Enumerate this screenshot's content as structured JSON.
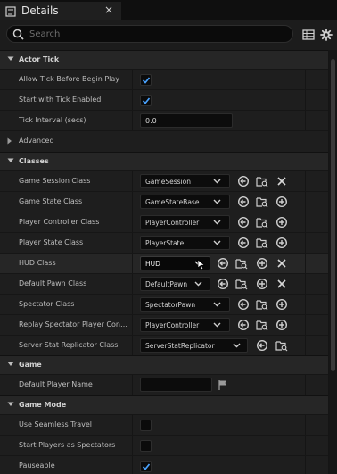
{
  "tab": {
    "title": "Details",
    "close": "×"
  },
  "search": {
    "placeholder": "Search",
    "value": ""
  },
  "sections": {
    "actor_tick": "Actor Tick",
    "classes": "Classes",
    "game": "Game",
    "game_mode": "Game Mode"
  },
  "actor_tick": {
    "allow_tick": {
      "label": "Allow Tick Before Begin Play",
      "checked": true
    },
    "start_tick": {
      "label": "Start with Tick Enabled",
      "checked": true
    },
    "tick_interval": {
      "label": "Tick Interval (secs)",
      "value": "0.0"
    },
    "advanced": "Advanced"
  },
  "classes": {
    "game_session": {
      "label": "Game Session Class",
      "value": "GameSession"
    },
    "game_state": {
      "label": "Game State Class",
      "value": "GameStateBase"
    },
    "player_controller": {
      "label": "Player Controller Class",
      "value": "PlayerController"
    },
    "player_state": {
      "label": "Player State Class",
      "value": "PlayerState"
    },
    "hud": {
      "label": "HUD Class",
      "value": "HUD"
    },
    "default_pawn": {
      "label": "Default Pawn Class",
      "value": "DefaultPawn"
    },
    "spectator": {
      "label": "Spectator Class",
      "value": "SpectatorPawn"
    },
    "replay_spectator": {
      "label": "Replay Spectator Player Contr…",
      "value": "PlayerController"
    },
    "server_stat": {
      "label": "Server Stat Replicator Class",
      "value": "ServerStatReplicator"
    }
  },
  "game": {
    "default_player_name": {
      "label": "Default Player Name",
      "value": ""
    }
  },
  "game_mode": {
    "seamless_travel": {
      "label": "Use Seamless Travel",
      "checked": false
    },
    "start_spectators": {
      "label": "Start Players as Spectators",
      "checked": false
    },
    "pauseable": {
      "label": "Pauseable",
      "checked": true
    }
  },
  "colors": {
    "accent": "#1f8fe6",
    "checkmark": "#4aa3ff"
  }
}
